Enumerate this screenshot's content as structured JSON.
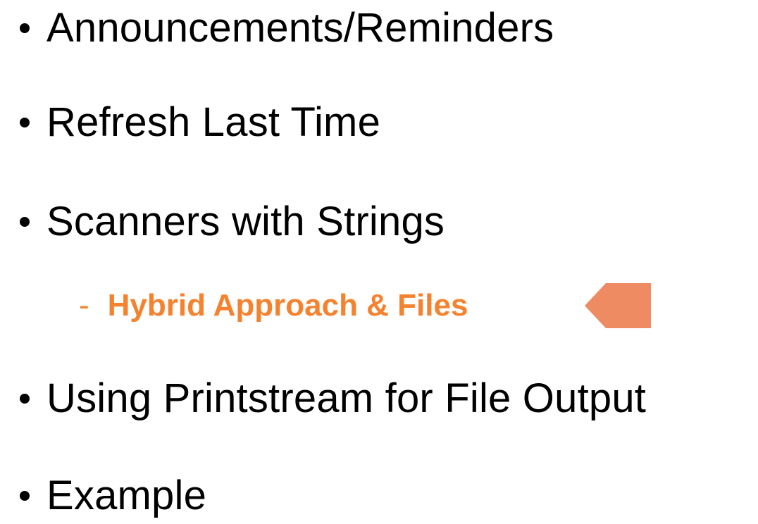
{
  "theme": {
    "text_color": "#000000",
    "accent_color": "#F5822E",
    "arrow_color": "#EE8B63"
  },
  "agenda": {
    "items": [
      {
        "label": "Announcements/Reminders"
      },
      {
        "label": "Refresh Last Time"
      },
      {
        "label": "Scanners with Strings"
      },
      {
        "label": "Using Printstream for File Output"
      },
      {
        "label": "Example"
      }
    ],
    "sub_item": {
      "marker": "-",
      "label": "Hybrid Approach & Files",
      "current_indicator_icon": "left-arrow-icon"
    }
  }
}
